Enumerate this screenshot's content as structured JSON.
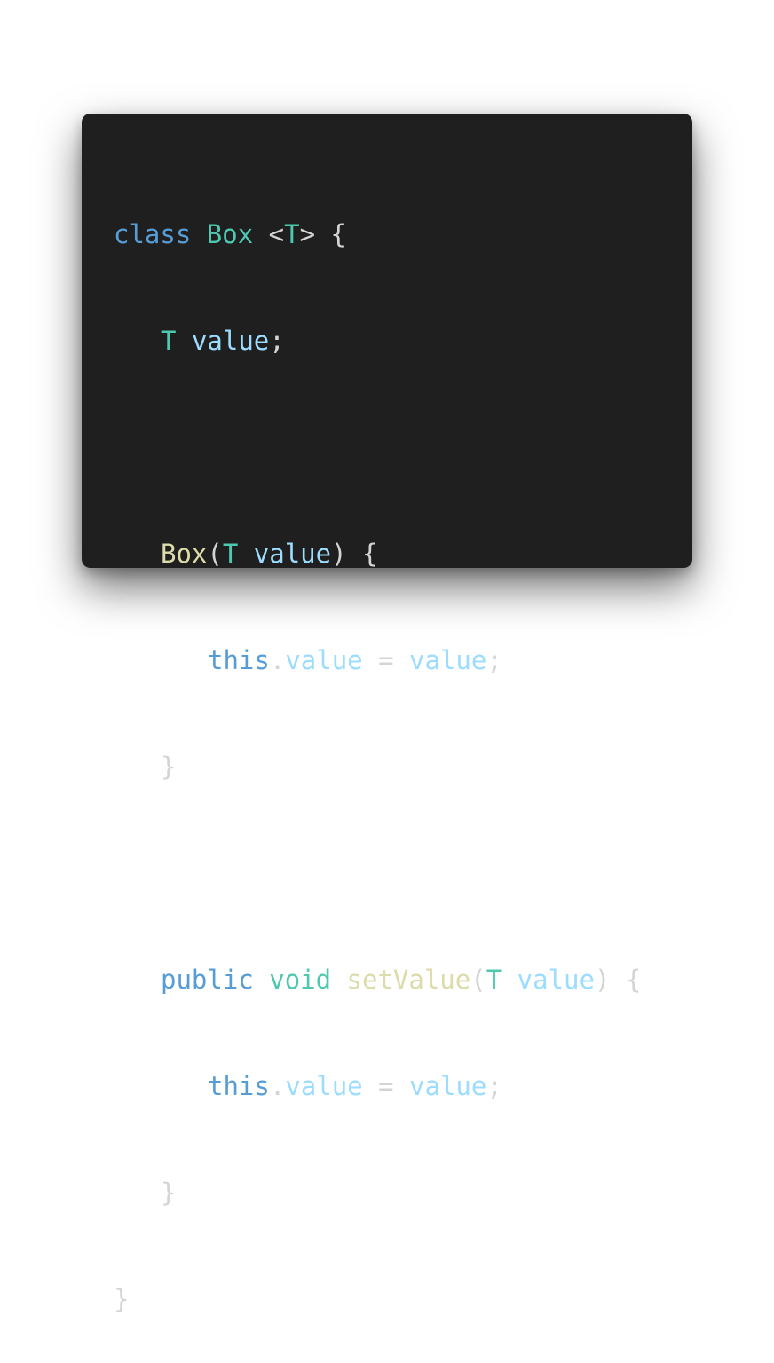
{
  "code": {
    "line1": {
      "kw": "class",
      "name": "Box",
      "open": "<",
      "tparam": "T",
      "close": ">",
      "brace": "{"
    },
    "line2": {
      "type": "T",
      "field": "value",
      "semi": ";"
    },
    "line4": {
      "ctor": "Box",
      "open": "(",
      "type": "T",
      "param": "value",
      "close": ")",
      "brace": "{"
    },
    "line5": {
      "this": "this",
      "dot": ".",
      "field": "value",
      "eq": "=",
      "rhs": "value",
      "semi": ";"
    },
    "line6": {
      "brace": "}"
    },
    "line8": {
      "mod": "public",
      "ret": "void",
      "fn": "setValue",
      "open": "(",
      "type": "T",
      "param": "value",
      "close": ")",
      "brace": "{"
    },
    "line9": {
      "this": "this",
      "dot": ".",
      "field": "value",
      "eq": "=",
      "rhs": "value",
      "semi": ";"
    },
    "line10": {
      "brace": "}"
    },
    "line11": {
      "brace": "}"
    }
  },
  "colors": {
    "background": "#1f1f1f",
    "keyword": "#569cd6",
    "type": "#4ec9b0",
    "function": "#dcdcaa",
    "variable": "#9cdcfe",
    "punctuation": "#d4d4d4"
  }
}
